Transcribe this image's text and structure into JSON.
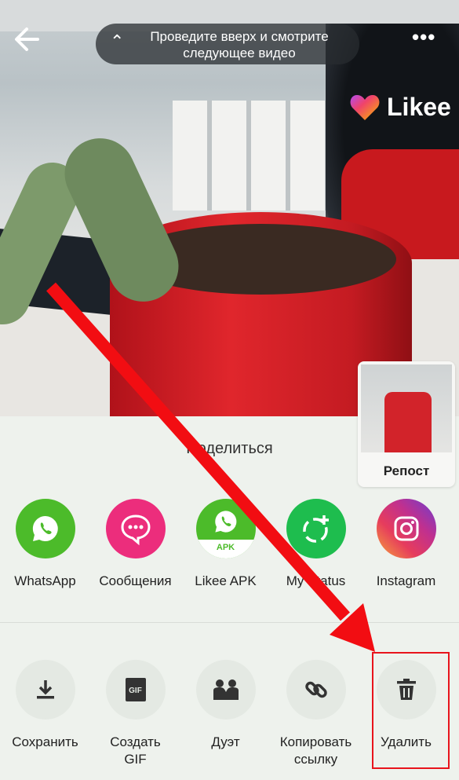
{
  "video": {
    "hint": "Проведите вверх и смотрите следующее видео",
    "logo": "Likee"
  },
  "share": {
    "title": "Поделиться",
    "repost": "Репост",
    "apps": [
      {
        "label": "WhatsApp",
        "icon": "whatsapp-icon",
        "color": "#4cbb2a"
      },
      {
        "label": "Сообщения",
        "icon": "messages-icon",
        "color": "#ec2d7c"
      },
      {
        "label": "Likee APK",
        "icon": "likee-apk-icon",
        "color": "#4cbb2a",
        "badge": "APK"
      },
      {
        "label": "My Status",
        "icon": "status-icon",
        "color": "#1ebd4e"
      },
      {
        "label": "Instagram",
        "icon": "instagram-icon",
        "color": "#c9318b"
      }
    ],
    "tools": [
      {
        "label": "Сохранить",
        "icon": "download-icon"
      },
      {
        "label": "Создать GIF",
        "icon": "gif-icon",
        "badge": "GIF"
      },
      {
        "label": "Дуэт",
        "icon": "duet-icon"
      },
      {
        "label": "Копировать ссылку",
        "icon": "link-icon"
      },
      {
        "label": "Удалить",
        "icon": "trash-icon"
      }
    ]
  },
  "annotation": {
    "color": "#e8141c"
  }
}
